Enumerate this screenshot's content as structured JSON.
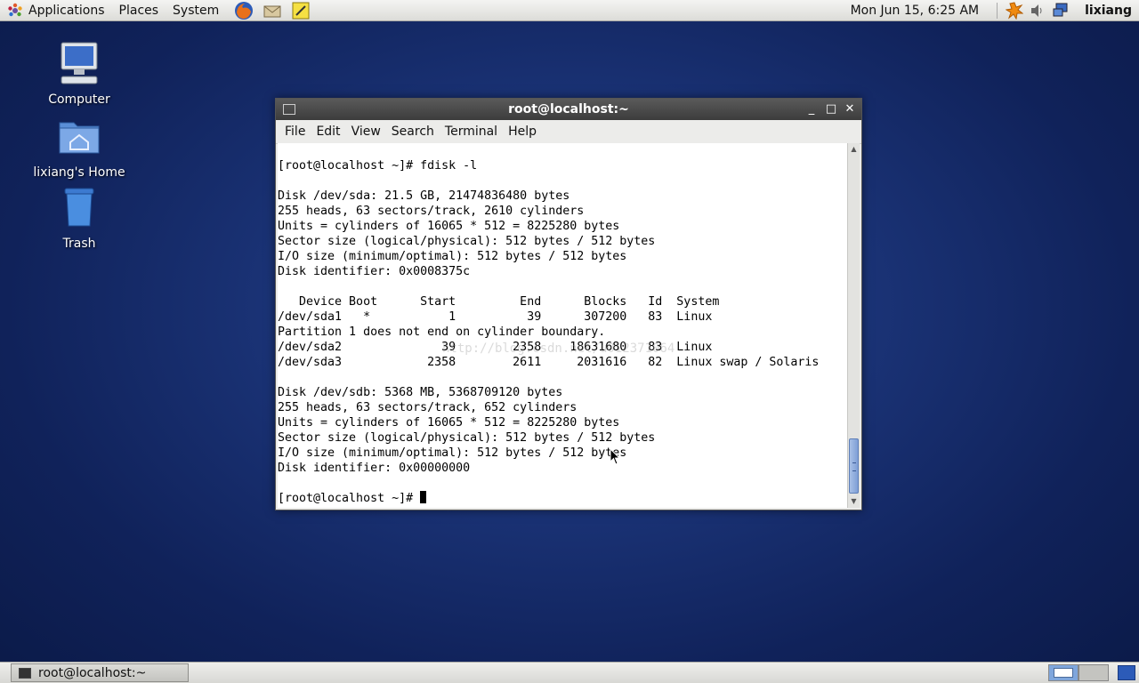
{
  "top_panel": {
    "menus": [
      "Applications",
      "Places",
      "System"
    ],
    "clock": "Mon Jun 15,  6:25 AM",
    "user": "lixiang"
  },
  "desktop_icons": [
    {
      "label": "Computer"
    },
    {
      "label": "lixiang's Home"
    },
    {
      "label": "Trash"
    }
  ],
  "terminal": {
    "title": "root@localhost:~",
    "menubar": [
      "File",
      "Edit",
      "View",
      "Search",
      "Terminal",
      "Help"
    ],
    "lines": [
      "",
      "[root@localhost ~]# fdisk -l",
      "",
      "Disk /dev/sda: 21.5 GB, 21474836480 bytes",
      "255 heads, 63 sectors/track, 2610 cylinders",
      "Units = cylinders of 16065 * 512 = 8225280 bytes",
      "Sector size (logical/physical): 512 bytes / 512 bytes",
      "I/O size (minimum/optimal): 512 bytes / 512 bytes",
      "Disk identifier: 0x0008375c",
      "",
      "   Device Boot      Start         End      Blocks   Id  System",
      "/dev/sda1   *           1          39      307200   83  Linux",
      "Partition 1 does not end on cylinder boundary.",
      "/dev/sda2              39        2358    18631680   83  Linux",
      "/dev/sda3            2358        2611     2031616   82  Linux swap / Solaris",
      "",
      "Disk /dev/sdb: 5368 MB, 5368709120 bytes",
      "255 heads, 63 sectors/track, 652 cylinders",
      "Units = cylinders of 16065 * 512 = 8225280 bytes",
      "Sector size (logical/physical): 512 bytes / 512 bytes",
      "I/O size (minimum/optimal): 512 bytes / 512 bytes",
      "Disk identifier: 0x00000000",
      ""
    ],
    "prompt": "[root@localhost ~]# ",
    "watermark": "http://blog.csdn.net/u012371064"
  },
  "bottom_panel": {
    "task_label": "root@localhost:~"
  },
  "colors": {
    "desktop": "#1b3478",
    "panel": "#e6e6e2",
    "titlebar": "#4a4a4a",
    "scroll_thumb": "#8fabde"
  }
}
